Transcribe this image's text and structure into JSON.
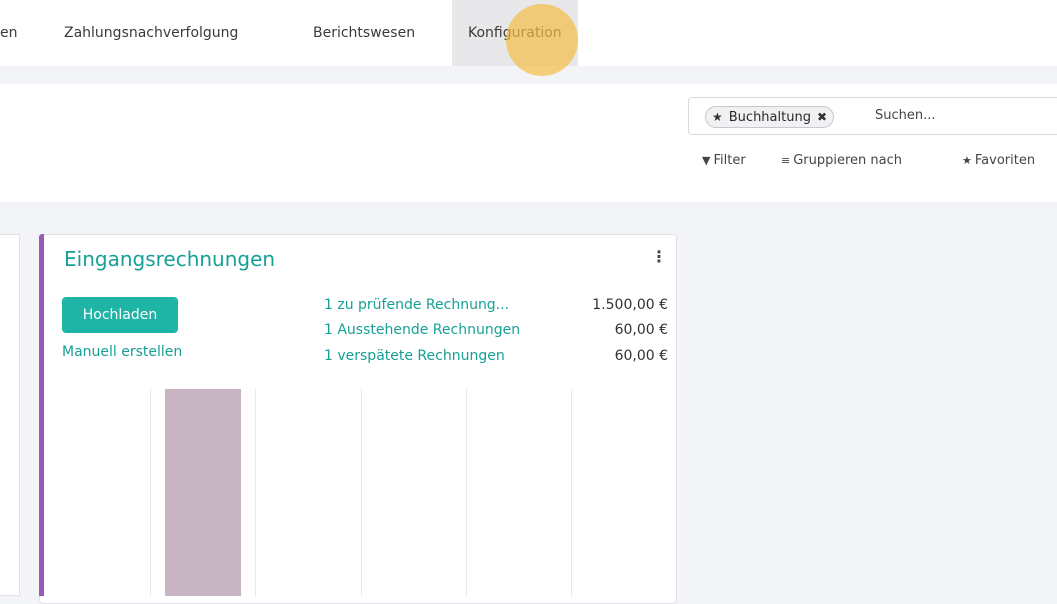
{
  "topbar": {
    "items": [
      {
        "label": "en"
      },
      {
        "label": "Zahlungsnachverfolgung"
      },
      {
        "label": "Berichtswesen"
      },
      {
        "label": "Konfiguration"
      }
    ]
  },
  "search": {
    "facet_label": "Buchhaltung",
    "placeholder": "Suchen..."
  },
  "control_panel": {
    "filter_label": "Filter",
    "groupby_label": "Gruppieren nach",
    "favorites_label": "Favoriten"
  },
  "card": {
    "title": "Eingangsrechnungen",
    "upload_label": "Hochladen",
    "create_label": "Manuell erstellen",
    "stats": [
      {
        "label": "1 zu prüfende Rechnung...",
        "value": "1.500,00 €"
      },
      {
        "label": "1 Ausstehende Rechnungen",
        "value": "60,00 €"
      },
      {
        "label": "1 verspätete Rechnungen",
        "value": "60,00 €"
      }
    ]
  },
  "colors": {
    "accent": "#1fb5a6",
    "link": "#16a096",
    "card_border_accent": "#9b59b6",
    "bar": "#c7b5c3",
    "highlight": "#f4be46"
  },
  "chart_data": {
    "type": "bar",
    "categories": [
      "",
      "",
      "",
      "",
      "",
      ""
    ],
    "values": [
      0,
      1,
      0,
      0,
      0,
      0
    ]
  }
}
